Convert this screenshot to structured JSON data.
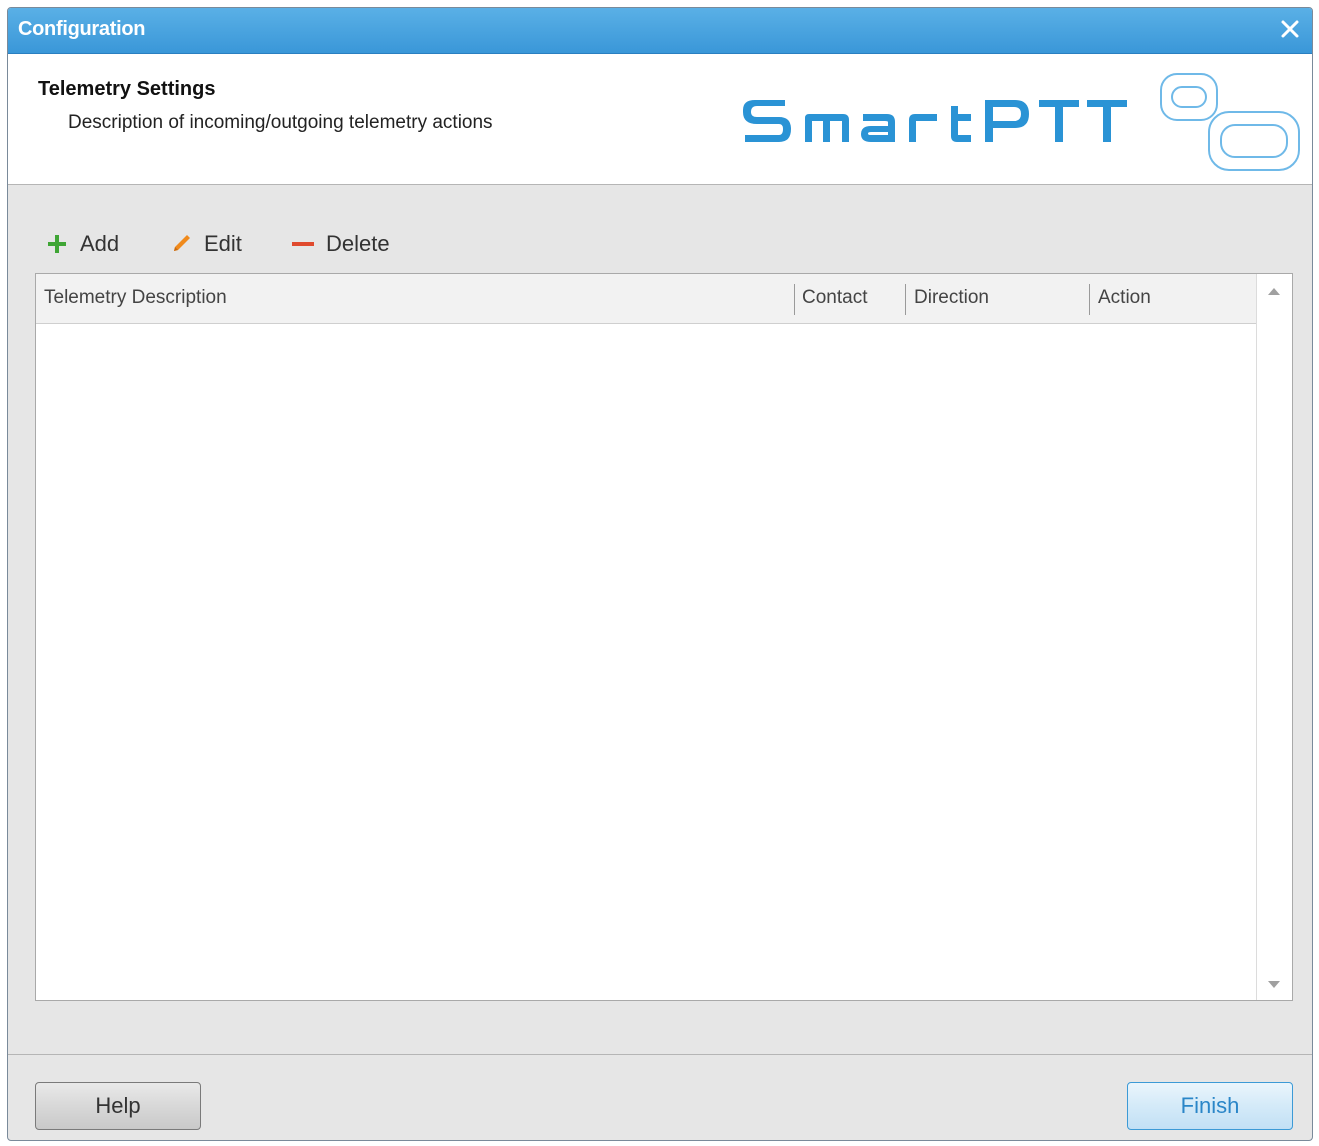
{
  "window": {
    "title": "Configuration"
  },
  "header": {
    "title": "Telemetry Settings",
    "subtitle": "Description of incoming/outgoing telemetry actions",
    "logo_text": "SmartPTT"
  },
  "toolbar": {
    "add_label": "Add",
    "edit_label": "Edit",
    "delete_label": "Delete"
  },
  "table": {
    "columns": [
      "Telemetry Description",
      "Contact",
      "Direction",
      "Action"
    ],
    "rows": []
  },
  "footer": {
    "help_label": "Help",
    "finish_label": "Finish"
  },
  "colors": {
    "titlebar": "#3a97d8",
    "brand": "#2a93d5",
    "add_icon": "#3fa535",
    "edit_icon": "#f08a1c",
    "delete_icon": "#e04a2e"
  }
}
